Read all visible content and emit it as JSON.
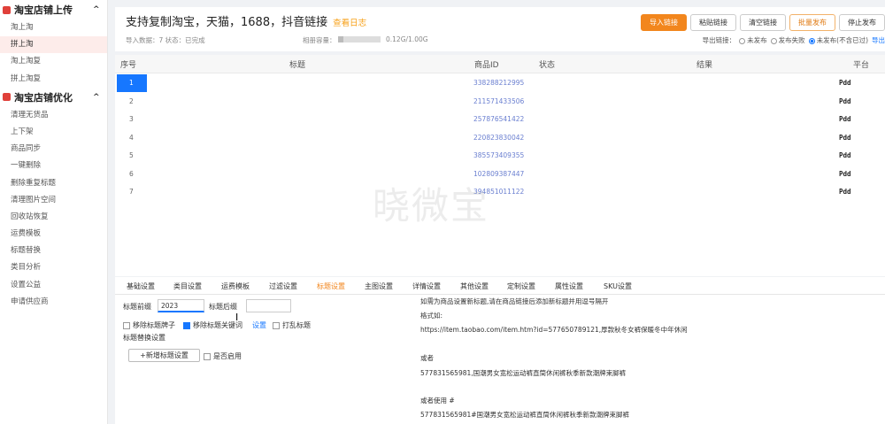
{
  "sidebar": {
    "sections": [
      {
        "label": "淘宝店铺上传",
        "items": [
          "淘上淘",
          "拼上淘",
          "淘上淘复",
          "拼上淘复"
        ],
        "active": 1
      },
      {
        "label": "淘宝店铺优化",
        "items": [
          "清理无货品",
          "上下架",
          "商品同步",
          "一键删除",
          "删除重复标题",
          "清理图片空间",
          "回收站恢复",
          "运费模板",
          "标题替换",
          "类目分析",
          "设置公益",
          "申请供应商"
        ]
      }
    ],
    "chevron": "^"
  },
  "header": {
    "title": "支持复制淘宝，天猫，1688，抖音链接",
    "log_link": "查看日志",
    "import_info": "导入数据：7 状态：已完成",
    "capacity_label": "相册容量：",
    "capacity_value": "0.12G/1.00G",
    "capacity_fraction": 0.12,
    "buttons": [
      "导入链接",
      "粘贴链接",
      "清空链接",
      "批量发布",
      "停止发布"
    ],
    "export_label": "导出链接：",
    "export_options": [
      "未发布",
      "发布失败",
      "未发布(不含已过)"
    ],
    "export_selected": 2,
    "export_link": "导出"
  },
  "table": {
    "columns": [
      "序号",
      "标题",
      "商品ID",
      "状态",
      "结果",
      "平台"
    ],
    "rows": [
      {
        "index": "1",
        "product_id": "",
        "platform": "Pdd"
      },
      {
        "index": "2",
        "product_id": "211571433506",
        "platform": "Pdd"
      },
      {
        "index": "3",
        "product_id": "257876541422",
        "platform": "Pdd"
      },
      {
        "index": "4",
        "product_id": "220823830042",
        "platform": "Pdd"
      },
      {
        "index": "5",
        "product_id": "385573409355",
        "platform": "Pdd"
      },
      {
        "index": "6",
        "product_id": "102809387447",
        "platform": "Pdd"
      },
      {
        "index": "7",
        "product_id": "394851011122",
        "platform": "Pdd"
      }
    ],
    "first_row_product_id": "338288212995",
    "selected_row": 0,
    "watermark": "晓微宝"
  },
  "bottom": {
    "tabs": [
      "基础设置",
      "类目设置",
      "运费模板",
      "过滤设置",
      "标题设置",
      "主图设置",
      "详情设置",
      "其他设置",
      "定制设置",
      "属性设置",
      "SKU设置"
    ],
    "active_tab": 4,
    "prefix_label": "标题前缀",
    "prefix_value": "2023",
    "suffix_label": "标题后缀",
    "suffix_value": "",
    "chk_remove_brand": "移除标题牌子",
    "chk_remove_keywords": "移除标题关键词",
    "settings_link": "设置",
    "chk_shuffle": "打乱标题",
    "replace_settings": "标题替换设置",
    "add_button": "+新增标题设置",
    "chk_enable": "是否启用",
    "instructions": [
      "如需为商品设置新标题,请在商品链接后添加新标题并用逗号隔开",
      "格式如:",
      "https://item.taobao.com/item.htm?id=577650789121,厚款秋冬女裤保暖冬中年休闲",
      "",
      "或者",
      "577831565981,国潮男女宽松运动裤直筒休闲裤秋季新款潮牌束脚裤",
      "",
      "或者使用 #",
      "577831565981#国潮男女宽松运动裤直筒休闲裤秋季新款潮牌束脚裤"
    ]
  }
}
